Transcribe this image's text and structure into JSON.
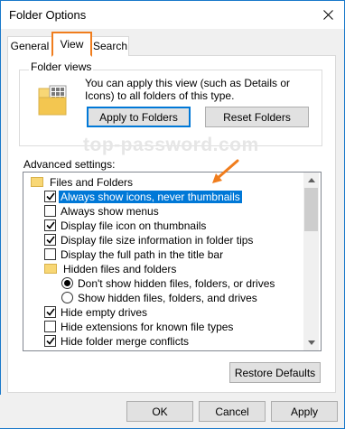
{
  "window": {
    "title": "Folder Options"
  },
  "tabs": [
    {
      "label": "General"
    },
    {
      "label": "View"
    },
    {
      "label": "Search"
    }
  ],
  "folder_views": {
    "label": "Folder views",
    "description": "You can apply this view (such as Details or Icons) to all folders of this type.",
    "apply_button": "Apply to Folders",
    "reset_button": "Reset Folders"
  },
  "watermark": "top-password.com",
  "advanced": {
    "label": "Advanced settings:",
    "items": [
      {
        "label": "Files and Folders",
        "kind": "folder"
      },
      {
        "label": "Always show icons, never thumbnails",
        "kind": "checkbox",
        "checked": true,
        "selected": true
      },
      {
        "label": "Always show menus",
        "kind": "checkbox",
        "checked": false
      },
      {
        "label": "Display file icon on thumbnails",
        "kind": "checkbox",
        "checked": true
      },
      {
        "label": "Display file size information in folder tips",
        "kind": "checkbox",
        "checked": true
      },
      {
        "label": "Display the full path in the title bar",
        "kind": "checkbox",
        "checked": false
      },
      {
        "label": "Hidden files and folders",
        "kind": "folder"
      },
      {
        "label": "Don't show hidden files, folders, or drives",
        "kind": "radio",
        "checked": true
      },
      {
        "label": "Show hidden files, folders, and drives",
        "kind": "radio",
        "checked": false
      },
      {
        "label": "Hide empty drives",
        "kind": "checkbox",
        "checked": true
      },
      {
        "label": "Hide extensions for known file types",
        "kind": "checkbox",
        "checked": false
      },
      {
        "label": "Hide folder merge conflicts",
        "kind": "checkbox",
        "checked": true
      }
    ]
  },
  "buttons": {
    "restore": "Restore Defaults",
    "ok": "OK",
    "cancel": "Cancel",
    "apply": "Apply"
  },
  "icons": {
    "close": "close-icon",
    "folder_view": "folder-view-icon",
    "check": "check-icon",
    "annotation_arrow": "arrow-icon"
  },
  "colors": {
    "accent": "#0078d7",
    "annotation": "#f07d1d",
    "folder": "#f8d775",
    "button_face": "#e1e1e1",
    "window_border": "#1979ca"
  }
}
